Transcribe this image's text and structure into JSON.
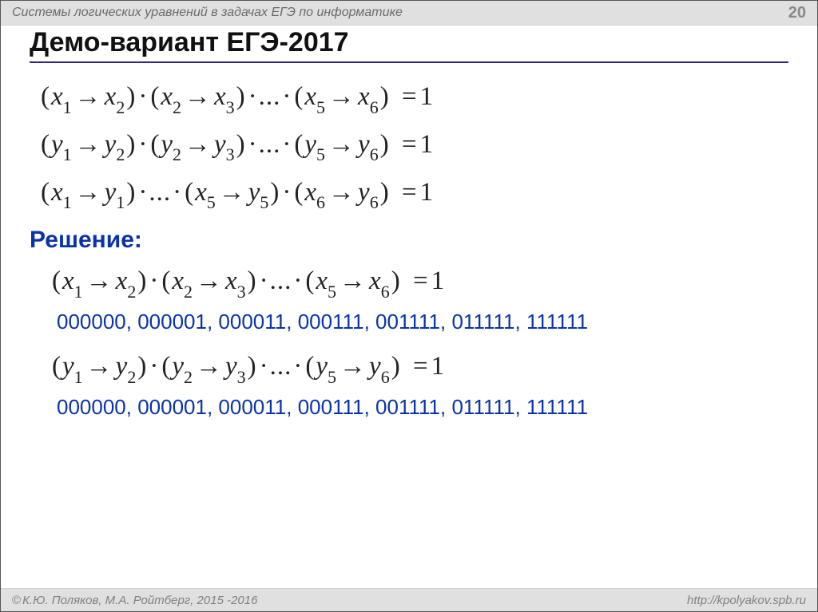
{
  "header": {
    "topic": "Системы логических уравнений в задачах ЕГЭ по информатике",
    "page": "20"
  },
  "title": "Демо-вариант ЕГЭ-2017",
  "sym": {
    "lp": "(",
    "rp": ")",
    "arrow": "→",
    "dot": "·",
    "ellipsis": "...",
    "eq": "=",
    "one": "1",
    "x": "x",
    "y": "y",
    "s1": "1",
    "s2": "2",
    "s3": "3",
    "s5": "5",
    "s6": "6"
  },
  "solution_label": "Решение:",
  "bits": {
    "row1": "000000, 000001, 000011, 000111, 001111, 011111, 111111",
    "row2": "000000, 000001, 000011, 000111, 001111, 011111, 111111"
  },
  "footer": {
    "authors_prefix": "©",
    "authors": "К.Ю. Поляков, М.А. Ройтберг, 2015 -2016",
    "url": "http://kpolyakov.spb.ru"
  }
}
